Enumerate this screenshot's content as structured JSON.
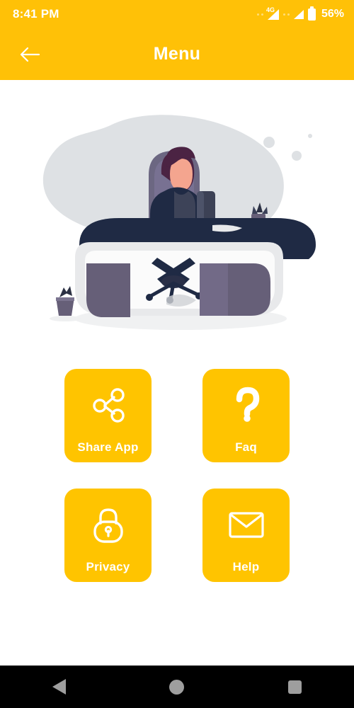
{
  "status_bar": {
    "time": "8:41 PM",
    "network_type": "4G",
    "battery_percent": "56%",
    "icons": [
      "signal-4g-icon",
      "signal-icon",
      "battery-icon"
    ],
    "background_color": "#FFC107",
    "text_color": "#FFFFFF"
  },
  "app_bar": {
    "title": "Menu",
    "back_icon": "arrow-left-icon",
    "background_color": "#FFC107",
    "title_color": "#FFFFFF"
  },
  "illustration": {
    "name": "person-at-desk-illustration",
    "alt": "Illustration of a person sitting at a curved desk with a chair, speaker and plants",
    "colors": {
      "blob": "#DEE1E4",
      "desk_top": "#1F2A44",
      "desk_front": "#E8E9EB",
      "panel": "#665F78",
      "chair": "#6C6782",
      "skin": "#F4A58F",
      "hair": "#4B2343",
      "shirt": "#1F2A44"
    }
  },
  "menu": {
    "tile_color": "#FFC400",
    "label_color": "#FFFFFF",
    "rows": [
      [
        {
          "id": "share-app",
          "label": "Share App",
          "icon": "share-icon"
        },
        {
          "id": "faq",
          "label": "Faq",
          "icon": "question-mark-icon"
        }
      ],
      [
        {
          "id": "privacy",
          "label": "Privacy",
          "icon": "lock-icon"
        },
        {
          "id": "help",
          "label": "Help",
          "icon": "envelope-icon"
        }
      ]
    ]
  },
  "nav_bar": {
    "background_color": "#000000",
    "icon_color": "#9E9E9E",
    "buttons": [
      {
        "id": "nav-back",
        "icon": "triangle-back-icon"
      },
      {
        "id": "nav-home",
        "icon": "circle-home-icon"
      },
      {
        "id": "nav-recents",
        "icon": "square-recents-icon"
      }
    ]
  }
}
